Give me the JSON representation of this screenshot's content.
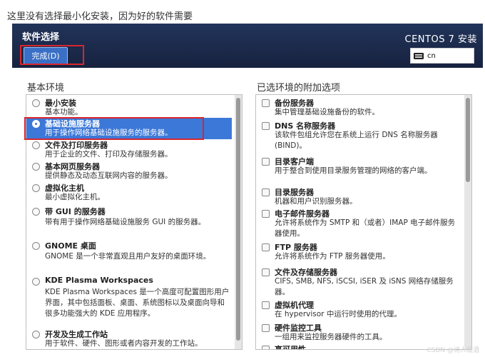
{
  "caption": "这里没有选择最小化安装，因为好的软件需要",
  "header": {
    "title": "软件选择",
    "done_label": "完成(D)",
    "product": "CENTOS 7 安装",
    "keyboard": "cn"
  },
  "left": {
    "title": "基本环境",
    "items": [
      {
        "name": "最小安装",
        "desc": "基本功能。",
        "selected": false
      },
      {
        "name": "基础设施服务器",
        "desc": "用于操作网络基础设施服务的服务器。",
        "selected": true
      },
      {
        "name": "文件及打印服务器",
        "desc": "用于企业的文件、打印及存储服务器。",
        "selected": false
      },
      {
        "name": "基本网页服务器",
        "desc": "提供静态及动态互联网内容的服务器。",
        "selected": false
      },
      {
        "name": "虚拟化主机",
        "desc": "最小虚拟化主机。",
        "selected": false
      },
      {
        "name": "带 GUI 的服务器",
        "desc": "带有用于操作网络基础设施服务 GUI 的服务器。",
        "selected": false
      },
      {
        "name": "GNOME 桌面",
        "desc": "GNOME 是一个非常直观且用户友好的桌面环境。",
        "selected": false
      },
      {
        "name": "KDE Plasma Workspaces",
        "desc": "KDE Plasma Workspaces 是一个高度可配置图形用户界面，其中包括面板、桌面、系统图标以及桌面向导和很多功能强大的 KDE 应用程序。",
        "selected": false
      },
      {
        "name": "开发及生成工作站",
        "desc": "用于软件、硬件、图形或者内容开发的工作站。",
        "selected": false
      }
    ]
  },
  "right": {
    "title": "已选环境的附加选项",
    "items": [
      {
        "name": "备份服务器",
        "desc": "集中管理基础设施备份的软件。"
      },
      {
        "name": "DNS 名称服务器",
        "desc": "该软件包组允许您在系统上运行 DNS 名称服务器 (BIND)。"
      },
      {
        "name": "目录客户端",
        "desc": "用于整合到使用目录服务管理的网络的客户端。"
      },
      {
        "name": "目录服务器",
        "desc": "机器和用户识别服务器。"
      },
      {
        "name": "电子邮件服务器",
        "desc": "允许将系统作为 SMTP 和（或者）IMAP 电子邮件服务器使用。"
      },
      {
        "name": "FTP 服务器",
        "desc": "允许将系统作为 FTP 服务器使用。"
      },
      {
        "name": "文件及存储服务器",
        "desc": "CIFS, SMB, NFS, iSCSI, iSER 及 iSNS 网络存储服务器。"
      },
      {
        "name": "虚拟机代理",
        "desc": "在 hypervisor 中运行时使用的代理。"
      },
      {
        "name": "硬件监控工具",
        "desc": "一组用来监控服务器硬件的工具。"
      },
      {
        "name": "高可用性",
        "desc": ""
      }
    ]
  },
  "watermark": "CSDN @诗人暖酒"
}
